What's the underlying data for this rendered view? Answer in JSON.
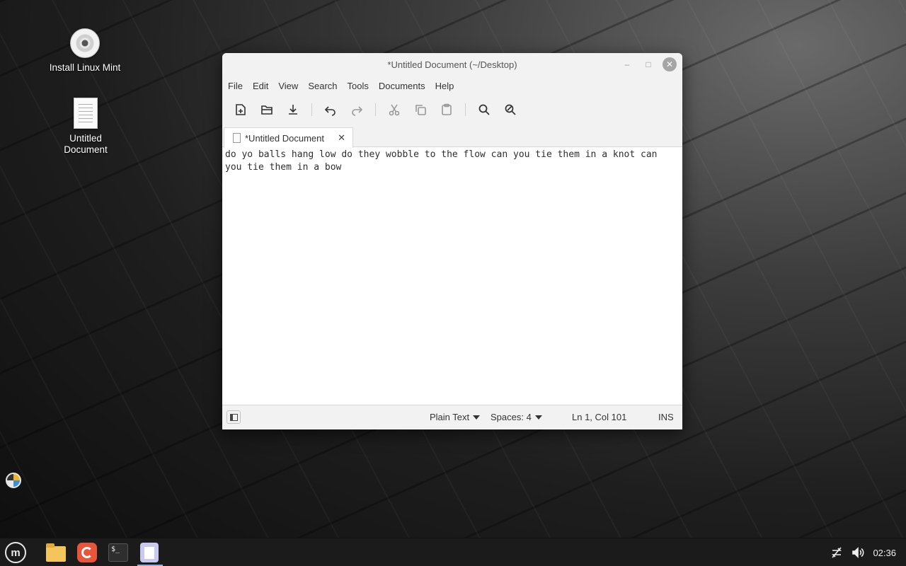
{
  "desktop": {
    "icons": [
      {
        "label": "Install Linux Mint",
        "icon": "cd-disc-icon"
      },
      {
        "label": "Untitled\nDocument",
        "icon": "text-file-icon"
      }
    ]
  },
  "window": {
    "title": "*Untitled Document (~/Desktop)",
    "controls": {
      "minimize": "–",
      "maximize": "□",
      "close": "✕"
    },
    "menu": [
      "File",
      "Edit",
      "View",
      "Search",
      "Tools",
      "Documents",
      "Help"
    ],
    "toolbar": [
      "new-document-icon",
      "open-folder-icon",
      "save-download-icon",
      "undo-icon",
      "redo-icon",
      "cut-icon",
      "copy-icon",
      "paste-icon",
      "search-icon",
      "replace-icon"
    ],
    "tab": {
      "label": "*Untitled Document",
      "close": "✕"
    },
    "content": "do yo balls hang low do they wobble to the flow can you tie them in a knot can\nyou tie them in a bow",
    "status": {
      "language": "Plain Text",
      "spaces": "Spaces: 4",
      "position": "Ln 1, Col 101",
      "mode": "INS"
    }
  },
  "taskbar": {
    "apps": [
      "menu",
      "files",
      "firefox",
      "terminal",
      "text-editor"
    ],
    "terminal_glyph": "$_",
    "mint_glyph": "m",
    "clock": "02:36"
  }
}
